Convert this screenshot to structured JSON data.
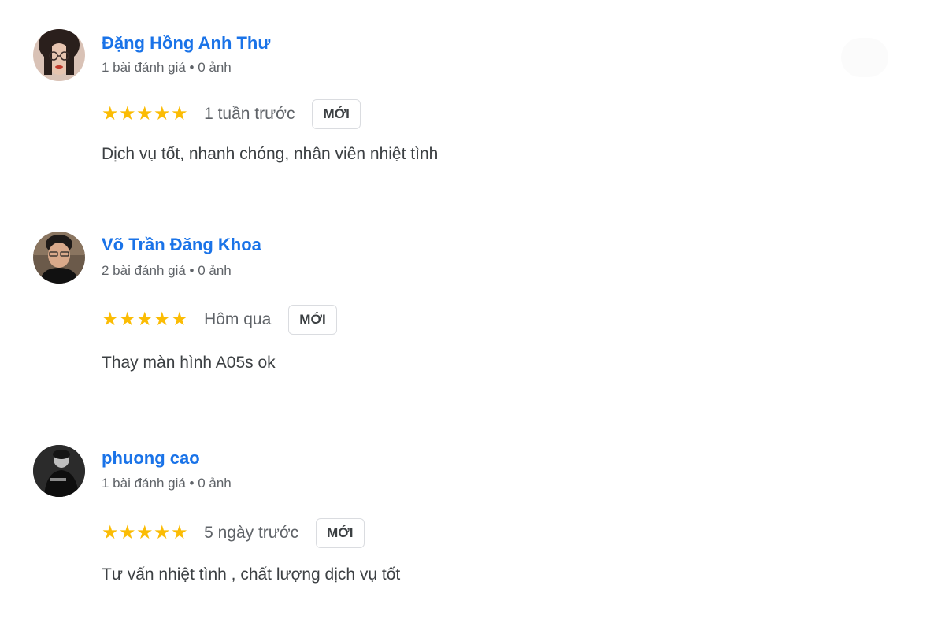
{
  "badge_new": "MỚI",
  "colors": {
    "name": "#1a73e8",
    "star": "#fbbc04",
    "meta": "#5f6368",
    "text": "#3c4043"
  },
  "reviews": [
    {
      "name": "Đặng Hồng Anh Thư",
      "meta": "1 bài đánh giá • 0 ảnh",
      "stars": "★★★★★",
      "rating": 5,
      "time": "1 tuần trước",
      "text": "Dịch vụ tốt, nhanh chóng, nhân viên nhiệt tình",
      "avatar": "user-avatar-photo"
    },
    {
      "name": "Võ Trần Đăng Khoa",
      "meta": "2 bài đánh giá • 0 ảnh",
      "stars": "★★★★★",
      "rating": 5,
      "time": "Hôm qua",
      "text": "Thay màn hình A05s ok",
      "avatar": "user-avatar-photo"
    },
    {
      "name": "phuong cao",
      "meta": "1 bài đánh giá • 0 ảnh",
      "stars": "★★★★★",
      "rating": 5,
      "time": "5 ngày trước",
      "text": "Tư vấn nhiệt tình , chất lượng dịch vụ tốt",
      "avatar": "user-avatar-photo"
    }
  ]
}
